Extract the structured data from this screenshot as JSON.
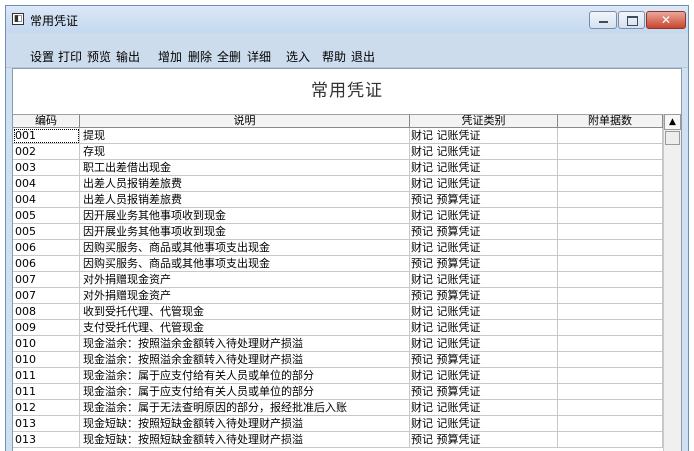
{
  "window": {
    "icon": "app-window-icon",
    "title": "常用凭证"
  },
  "toolbar": {
    "items": [
      "设置",
      "打印",
      "预览",
      "输出",
      "增加",
      "删除",
      "全删",
      "详细",
      "选入",
      "帮助",
      "退出"
    ]
  },
  "form": {
    "title": "常用凭证"
  },
  "table": {
    "headers": [
      "编码",
      "说明",
      "凭证类别",
      "附单据数"
    ],
    "rows": [
      [
        "001",
        "提现",
        "财记 记账凭证",
        ""
      ],
      [
        "002",
        "存现",
        "财记 记账凭证",
        ""
      ],
      [
        "003",
        "职工出差借出现金",
        "财记 记账凭证",
        ""
      ],
      [
        "004",
        "出差人员报销差旅费",
        "财记 记账凭证",
        ""
      ],
      [
        "004",
        "出差人员报销差旅费",
        "预记 预算凭证",
        ""
      ],
      [
        "005",
        "因开展业务其他事项收到现金",
        "财记 记账凭证",
        ""
      ],
      [
        "005",
        "因开展业务其他事项收到现金",
        "预记 预算凭证",
        ""
      ],
      [
        "006",
        "因购买服务、商品或其他事项支出现金",
        "财记 记账凭证",
        ""
      ],
      [
        "006",
        "因购买服务、商品或其他事项支出现金",
        "预记 预算凭证",
        ""
      ],
      [
        "007",
        "对外捐赠现金资产",
        "财记 记账凭证",
        ""
      ],
      [
        "007",
        "对外捐赠现金资产",
        "预记 预算凭证",
        ""
      ],
      [
        "008",
        "收到受托代理、代管现金",
        "财记 记账凭证",
        ""
      ],
      [
        "009",
        "支付受托代理、代管现金",
        "财记 记账凭证",
        ""
      ],
      [
        "010",
        "现金溢余：按照溢余金额转入待处理财产损溢",
        "财记 记账凭证",
        ""
      ],
      [
        "010",
        "现金溢余：按照溢余金额转入待处理财产损溢",
        "预记 预算凭证",
        ""
      ],
      [
        "011",
        "现金溢余：属于应支付给有关人员或单位的部分",
        "财记 记账凭证",
        ""
      ],
      [
        "011",
        "现金溢余：属于应支付给有关人员或单位的部分",
        "预记 预算凭证",
        ""
      ],
      [
        "012",
        "现金溢余：属于无法查明原因的部分，报经批准后入账",
        "财记 记账凭证",
        ""
      ],
      [
        "013",
        "现金短缺：按照短缺金额转入待处理财产损溢",
        "财记 记账凭证",
        ""
      ],
      [
        "013",
        "现金短缺：按照短缺金额转入待处理财产损溢",
        "预记 预算凭证",
        ""
      ]
    ]
  },
  "scrollbar": {
    "up_arrow": "▲"
  },
  "colors": {
    "window_bg": "#cfe0f3",
    "close_button": "#c9452f",
    "grid_line": "#c8c8c8"
  }
}
